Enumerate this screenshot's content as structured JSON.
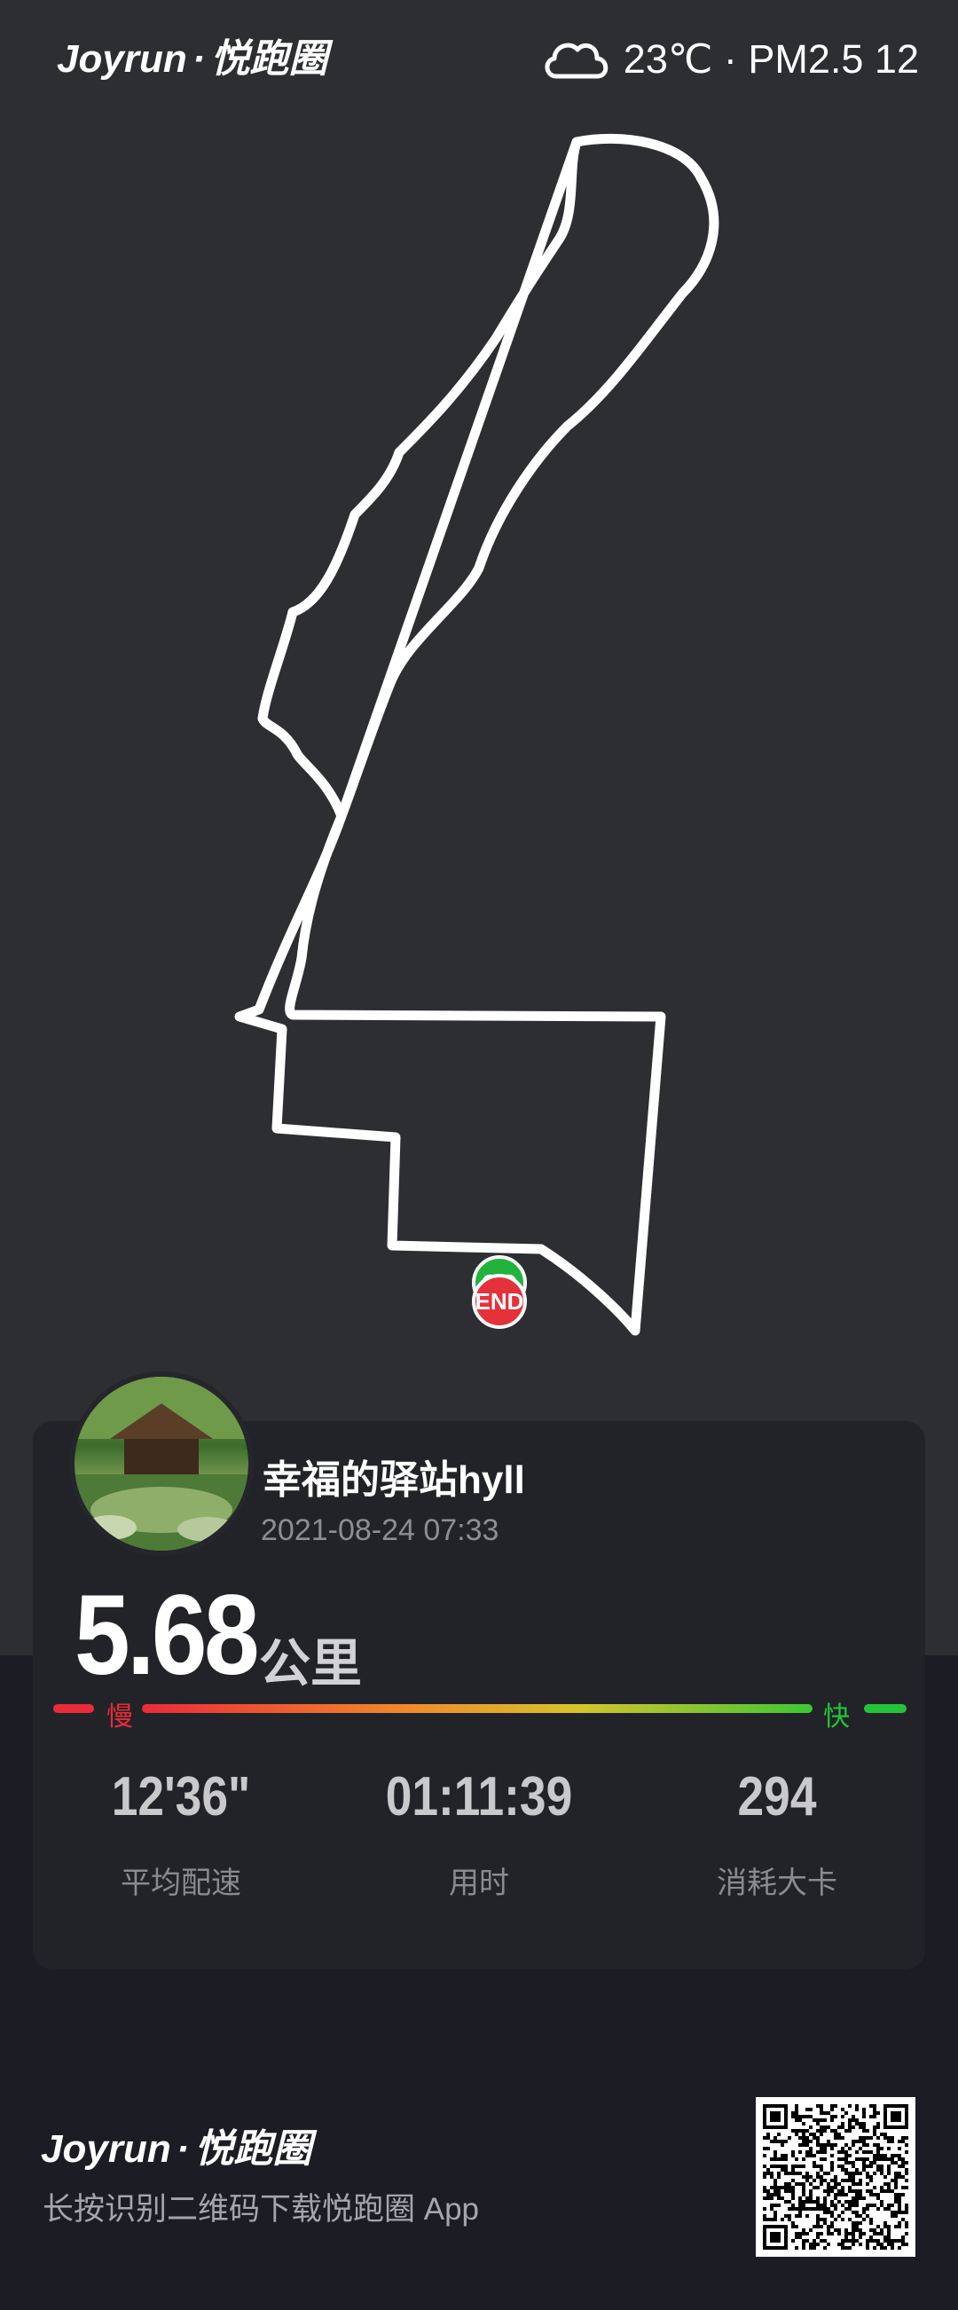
{
  "brand": {
    "name": "Joyrun",
    "dot": "·",
    "cn": "悦跑圈"
  },
  "weather": {
    "icon": "cloud-icon",
    "text": "23℃ · PM2.5 12"
  },
  "map": {
    "start_marker": "GO",
    "end_marker": "END"
  },
  "user": {
    "name": "幸福的驿站hyll",
    "datetime": "2021-08-24 07:33",
    "avatar_icon": "garden-pavilion-avatar"
  },
  "distance": {
    "value": "5.68",
    "unit": "公里"
  },
  "pace_bar": {
    "slow": "慢",
    "fast": "快"
  },
  "stats": {
    "pace": {
      "value": "12'36\"",
      "label": "平均配速"
    },
    "time": {
      "value": "01:11:39",
      "label": "用时"
    },
    "calories": {
      "value": "294",
      "label": "消耗大卡"
    }
  },
  "footer": {
    "text": "长按识别二维码下载悦跑圈 App"
  },
  "colors": {
    "map_bg": "#2d2e31",
    "card_bg": "#222328",
    "slow": "#ea2b39",
    "fast": "#24c43a"
  }
}
